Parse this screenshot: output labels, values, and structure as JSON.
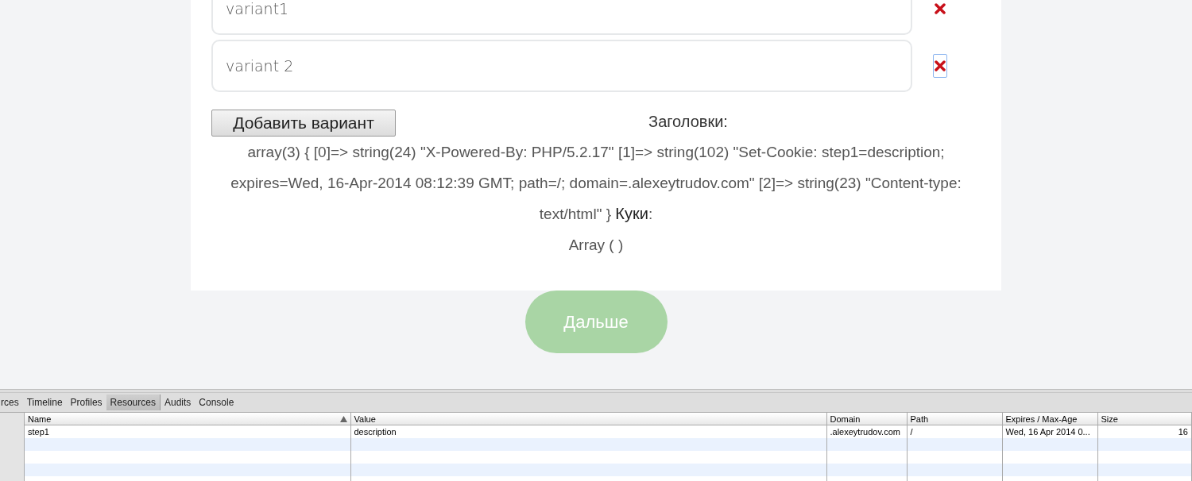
{
  "variants": [
    {
      "value": "variant1",
      "delete_focused": false
    },
    {
      "value": "variant 2",
      "delete_focused": true
    }
  ],
  "add_button": "Добавить вариант",
  "headers_title": "Заголовки:",
  "headers_dump": "array(3) { [0]=> string(24) \"X-Powered-By: PHP/5.2.17\" [1]=> string(102) \"Set-Cookie: step1=description; expires=Wed, 16-Apr-2014 08:12:39 GMT; path=/; domain=.alexeytrudov.com\" [2]=> string(23) \"Content-type: text/html\" } **Куки**:",
  "cookies_dump": "Array ( )",
  "next_button": "Дальше",
  "devtools": {
    "tabs": [
      {
        "label": "rces",
        "selected": false
      },
      {
        "label": "Timeline",
        "selected": false
      },
      {
        "label": "Profiles",
        "selected": false
      },
      {
        "label": "Resources",
        "selected": true
      },
      {
        "label": "Audits",
        "selected": false
      },
      {
        "label": "Console",
        "selected": false
      }
    ],
    "columns": [
      {
        "label": "Name",
        "sorted": true
      },
      {
        "label": "Value",
        "sorted": false
      },
      {
        "label": "Domain",
        "sorted": false
      },
      {
        "label": "Path",
        "sorted": false
      },
      {
        "label": "Expires / Max-Age",
        "sorted": false
      },
      {
        "label": "Size",
        "sorted": false
      }
    ],
    "rows": [
      [
        "step1",
        "description",
        ".alexeytrudov.com",
        "/",
        "Wed, 16 Apr 2014 0...",
        "16"
      ]
    ]
  }
}
